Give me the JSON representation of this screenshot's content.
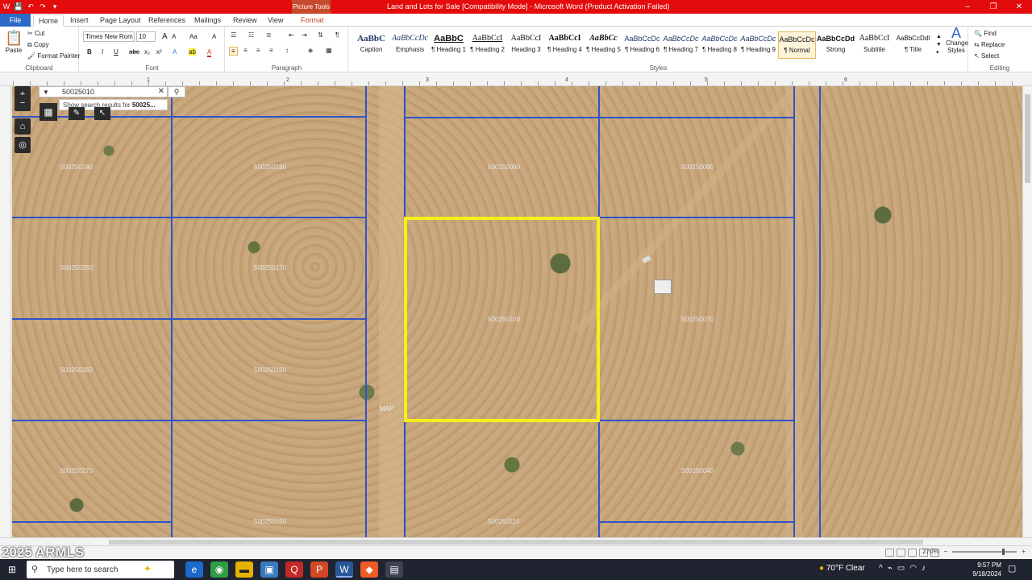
{
  "window": {
    "doc_title": "Land and Lots for Sale [Compatibility Mode] - Microsoft Word (Product Activation Failed)",
    "context_tab": "Picture Tools",
    "controls": [
      "–",
      "❐",
      "✕"
    ]
  },
  "quick_access": [
    "W",
    "💾",
    "↶",
    "↷",
    "▾"
  ],
  "tabs": [
    {
      "label": "File"
    },
    {
      "label": "Home"
    },
    {
      "label": "Insert"
    },
    {
      "label": "Page Layout"
    },
    {
      "label": "References"
    },
    {
      "label": "Mailings"
    },
    {
      "label": "Review"
    },
    {
      "label": "View"
    },
    {
      "label": "Format"
    }
  ],
  "ribbon": {
    "clipboard": {
      "paste": "Paste",
      "cut": "Cut",
      "copy": "Copy",
      "format_painter": "Format Painter",
      "label": "Clipboard"
    },
    "font": {
      "name": "Times New Rom",
      "size": "10",
      "label": "Font",
      "bold": "B",
      "italic": "I",
      "underline": "U",
      "strike": "abc",
      "sub": "x₂",
      "sup": "x²",
      "grow": "A",
      "shrink": "A",
      "case": "Aa",
      "clear": "A",
      "highlight": "ab",
      "color": "A"
    },
    "paragraph": {
      "label": "Paragraph"
    },
    "styles": {
      "label": "Styles",
      "items": [
        {
          "sample": "AaBbC",
          "name": "Caption"
        },
        {
          "sample": "AaBbCcDc",
          "name": "Emphasis"
        },
        {
          "sample": "AaBbC",
          "name": "¶ Heading 1"
        },
        {
          "sample": "AaBbCcI",
          "name": "¶ Heading 2"
        },
        {
          "sample": "AaBbCcI",
          "name": "Heading 3"
        },
        {
          "sample": "AaBbCcI",
          "name": "¶ Heading 4"
        },
        {
          "sample": "AaBbCc",
          "name": "¶ Heading 5"
        },
        {
          "sample": "AaBbCcDc",
          "name": "¶ Heading 6"
        },
        {
          "sample": "AaBbCcDc",
          "name": "¶ Heading 7"
        },
        {
          "sample": "AaBbCcDc",
          "name": "¶ Heading 8"
        },
        {
          "sample": "AaBbCcDc",
          "name": "¶ Heading 9"
        },
        {
          "sample": "AaBbCcDc",
          "name": "¶ Normal"
        },
        {
          "sample": "AaBbCcDd",
          "name": "Strong"
        },
        {
          "sample": "AaBbCcI",
          "name": "Subtitle"
        },
        {
          "sample": "AaBbCcDdI",
          "name": "¶ Title"
        }
      ],
      "change": "Change Styles"
    },
    "editing": {
      "label": "Editing",
      "find": "Find",
      "replace": "Replace",
      "select": "Select"
    }
  },
  "ruler": {
    "marks": [
      "1",
      "2",
      "3",
      "4",
      "5",
      "6"
    ]
  },
  "map": {
    "search_value": "50025010",
    "search_hint": "Show search results for",
    "search_hint_bold": "50025...",
    "road_label": "MAP",
    "parcels": [
      "500250240",
      "500250180",
      "500250090",
      "500250080",
      "500250250",
      "500250170",
      "500250100",
      "500250070",
      "500250260",
      "500250160",
      "500250050",
      "500250270",
      "500250150",
      "500250110",
      "500250040"
    ]
  },
  "status": {
    "watermark": "2025 ARMLS",
    "zoom": "270%"
  },
  "taskbar": {
    "search_placeholder": "Type here to search",
    "weather": "70°F  Clear",
    "time": "9:57 PM",
    "date": "9/18/2024"
  },
  "colors": {
    "title_bar": "#e30b0b",
    "selection_box": "#f7ee1a",
    "parcel_lines": "#2f55c8"
  }
}
